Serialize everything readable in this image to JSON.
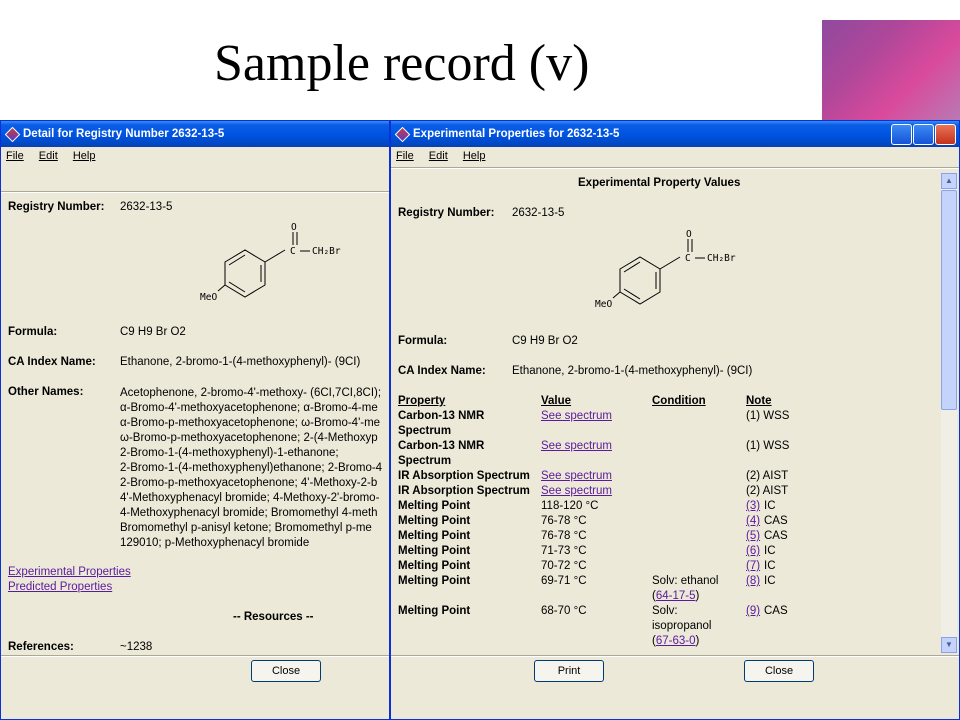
{
  "slide": {
    "title": "Sample record (v)"
  },
  "left_window": {
    "title": "Detail for Registry Number 2632-13-5",
    "menu": [
      "File",
      "Edit",
      "Help"
    ],
    "registry_label": "Registry Number:",
    "registry_value": "2632-13-5",
    "formula_label": "Formula:",
    "formula_value": "C9 H9 Br O2",
    "ca_label": "CA Index Name:",
    "ca_value": "Ethanone, 2-bromo-1-(4-methoxyphenyl)- (9CI)",
    "other_label": "Other Names:",
    "other_names": [
      "Acetophenone, 2-bromo-4'-methoxy- (6CI,7CI,8CI);",
      "α-Bromo-4'-methoxyacetophenone; α-Bromo-4-me",
      "α-Bromo-p-methoxyacetophenone; ω-Bromo-4'-me",
      "ω-Bromo-p-methoxyacetophenone; 2-(4-Methoxyp",
      "2-Bromo-1-(4-methoxyphenyl)-1-ethanone;",
      "2-Bromo-1-(4-methoxyphenyl)ethanone; 2-Bromo-4",
      "2-Bromo-p-methoxyacetophenone; 4'-Methoxy-2-b",
      "4'-Methoxyphenacyl bromide; 4-Methoxy-2'-bromo-",
      "4-Methoxyphenacyl bromide; Bromomethyl 4-meth",
      "Bromomethyl p-anisyl ketone; Bromomethyl p-me",
      "129010; p-Methoxyphenacyl bromide"
    ],
    "link_experimental": "Experimental Properties",
    "link_predicted": "Predicted Properties",
    "resources_heading": "-- Resources --",
    "references_label": "References:",
    "references_value": "~1238",
    "close_label": "Close"
  },
  "right_window": {
    "title": "Experimental Properties for 2632-13-5",
    "menu": [
      "File",
      "Edit",
      "Help"
    ],
    "heading": "Experimental Property Values",
    "registry_label": "Registry Number:",
    "registry_value": "2632-13-5",
    "formula_label": "Formula:",
    "formula_value": "C9 H9 Br O2",
    "ca_label": "CA Index Name:",
    "ca_value": "Ethanone, 2-bromo-1-(4-methoxyphenyl)- (9CI)",
    "table_headers": [
      "Property",
      "Value",
      "Condition",
      "Note"
    ],
    "rows": [
      {
        "property": "Carbon-13 NMR",
        "value": "See spectrum",
        "note_ref": "",
        "note": "(1) WSS"
      },
      {
        "property": "Spectrum"
      },
      {
        "property": "Carbon-13 NMR",
        "value": "See spectrum",
        "note_ref": "",
        "note": "(1) WSS"
      },
      {
        "property": "Spectrum"
      },
      {
        "property": "IR Absorption Spectrum",
        "value": "See spectrum",
        "note_ref": "",
        "note": "(2) AIST"
      },
      {
        "property": "IR Absorption Spectrum",
        "value": "See spectrum",
        "note_ref": "",
        "note": "(2) AIST"
      },
      {
        "property": "Melting Point",
        "value": "118-120 °C",
        "note_ref": "(3)",
        "note": "IC"
      },
      {
        "property": "Melting Point",
        "value": "76-78 °C",
        "note_ref": "(4)",
        "note": "CAS"
      },
      {
        "property": "Melting Point",
        "value": "76-78 °C",
        "note_ref": "(5)",
        "note": "CAS"
      },
      {
        "property": "Melting Point",
        "value": "71-73 °C",
        "note_ref": "(6)",
        "note": "IC"
      },
      {
        "property": "Melting Point",
        "value": "70-72 °C",
        "note_ref": "(7)",
        "note": "IC"
      },
      {
        "property": "Melting Point",
        "value": "69-71 °C",
        "condition": "Solv: ethanol",
        "note_ref": "(8)",
        "note": "IC"
      },
      {
        "condition_link_open": "(",
        "condition_link": "64-17-5",
        "condition_link_close": ")"
      },
      {
        "property": "Melting Point",
        "value": "68-70 °C",
        "condition": "Solv:",
        "note_ref": "(9)",
        "note": "CAS"
      },
      {
        "condition": "isopropanol"
      },
      {
        "condition_link_open": "(",
        "condition_link": "67-63-0",
        "condition_link_close": ")"
      }
    ],
    "print_label": "Print",
    "close_label": "Close"
  },
  "structure": {
    "atoms": [
      "O",
      "C",
      "CH₂Br",
      "MeO"
    ]
  }
}
